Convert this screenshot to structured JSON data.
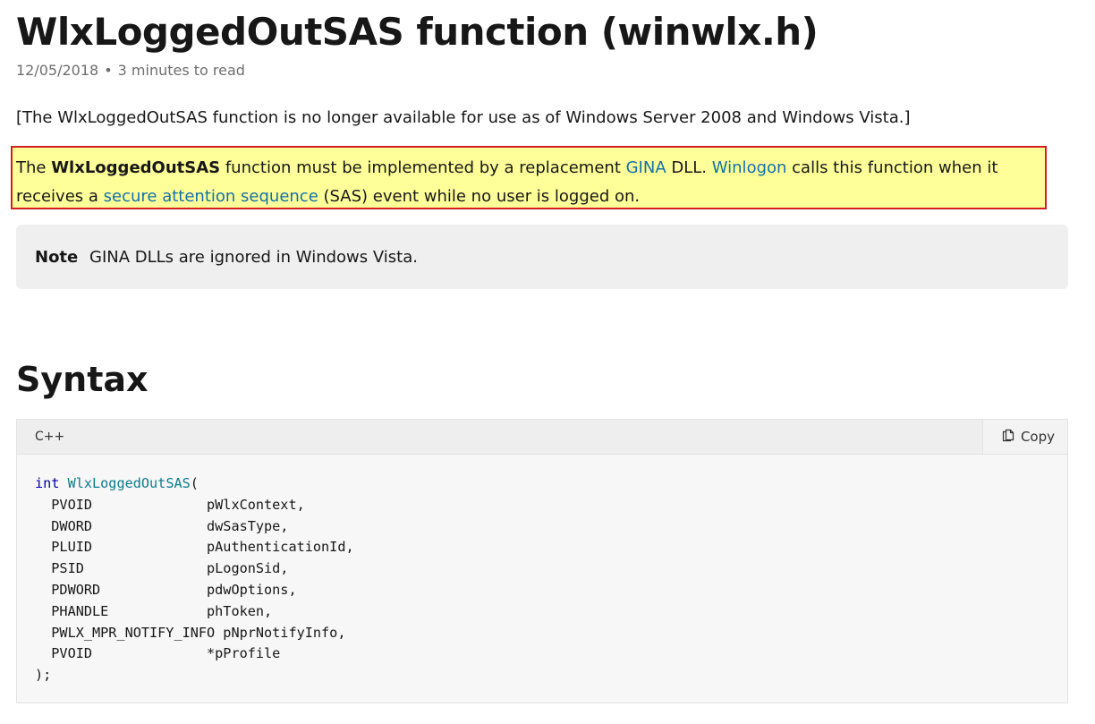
{
  "page": {
    "title": "WlxLoggedOutSAS function (winwlx.h)",
    "date": "12/05/2018",
    "separator": "•",
    "read_time": "3 minutes to read"
  },
  "deprecation_notice": "[The WlxLoggedOutSAS function is no longer available for use as of Windows Server 2008 and Windows Vista.]",
  "description": {
    "text_1": "The ",
    "bold_name": "WlxLoggedOutSAS",
    "text_2": " function must be implemented by a replacement ",
    "link_gina": "GINA",
    "text_3": " DLL. ",
    "link_winlogon": "Winlogon",
    "text_4": " calls this function when it receives a ",
    "link_sas": "secure attention sequence",
    "text_5": " (SAS) event while no user is logged on.",
    "highlight_color": "#ffff99",
    "border_color": "#d11f1f",
    "link_color": "#1470a6"
  },
  "note": {
    "label": "Note",
    "text": "GINA DLLs are ignored in Windows Vista."
  },
  "syntax": {
    "heading": "Syntax",
    "language": "C++",
    "copy_label": "Copy",
    "copy_icon": "copy-icon",
    "keyword": "int",
    "function_name": "WlxLoggedOutSAS",
    "open": "(",
    "params": [
      "  PVOID              pWlxContext,",
      "  DWORD              dwSasType,",
      "  PLUID              pAuthenticationId,",
      "  PSID               pLogonSid,",
      "  PDWORD             pdwOptions,",
      "  PHANDLE            phToken,",
      "  PWLX_MPR_NOTIFY_INFO pNprNotifyInfo,",
      "  PVOID              *pProfile"
    ],
    "close": ");"
  }
}
